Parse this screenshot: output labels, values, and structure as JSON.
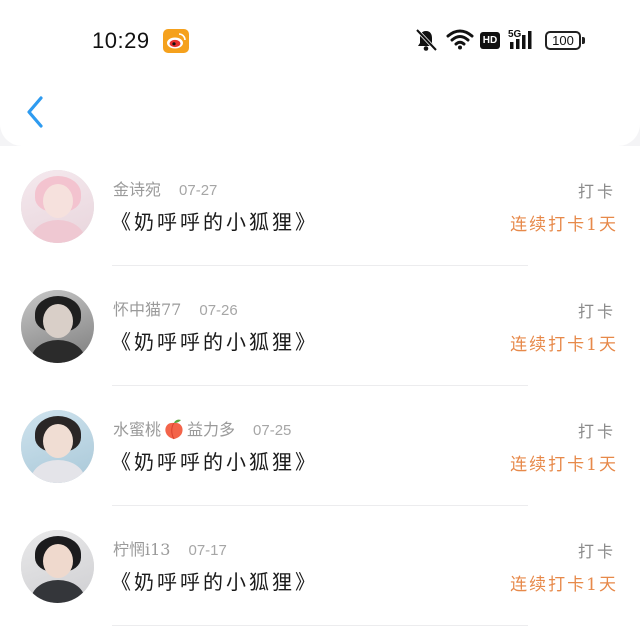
{
  "status_bar": {
    "time": "10:29",
    "battery": "100",
    "network": "5G",
    "hd_label": "HD",
    "icons": [
      "weibo-icon",
      "mute-icon",
      "wifi-icon",
      "hd-icon",
      "signal-icon",
      "battery-icon"
    ]
  },
  "header": {
    "back_icon": "chevron-left-icon",
    "accent_color": "#2e9bf0"
  },
  "list": {
    "items": [
      {
        "username": "金诗宛",
        "date": "07-27",
        "title": "《奶呼呼的小狐狸》",
        "action_label": "打卡",
        "streak_label": "连续打卡1天",
        "avatar": "avatar-pink-hair"
      },
      {
        "username": "怀中猫77",
        "date": "07-26",
        "title": "《奶呼呼的小狐狸》",
        "action_label": "打卡",
        "streak_label": "连续打卡1天",
        "avatar": "avatar-cat-ears"
      },
      {
        "username_before_emoji": "水蜜桃",
        "username_after_emoji": "益力多",
        "date": "07-25",
        "title": "《奶呼呼的小狐狸》",
        "action_label": "打卡",
        "streak_label": "连续打卡1天",
        "avatar": "avatar-long-hair",
        "emoji": "peach-icon"
      },
      {
        "username": "柠惘i13",
        "date": "07-17",
        "title": "《奶呼呼的小狐狸》",
        "action_label": "打卡",
        "streak_label": "连续打卡1天",
        "avatar": "avatar-dark-hair"
      }
    ]
  },
  "colors": {
    "streak": "#e7894a",
    "action": "#8a8a8a",
    "meta": "#9a9a9a"
  }
}
